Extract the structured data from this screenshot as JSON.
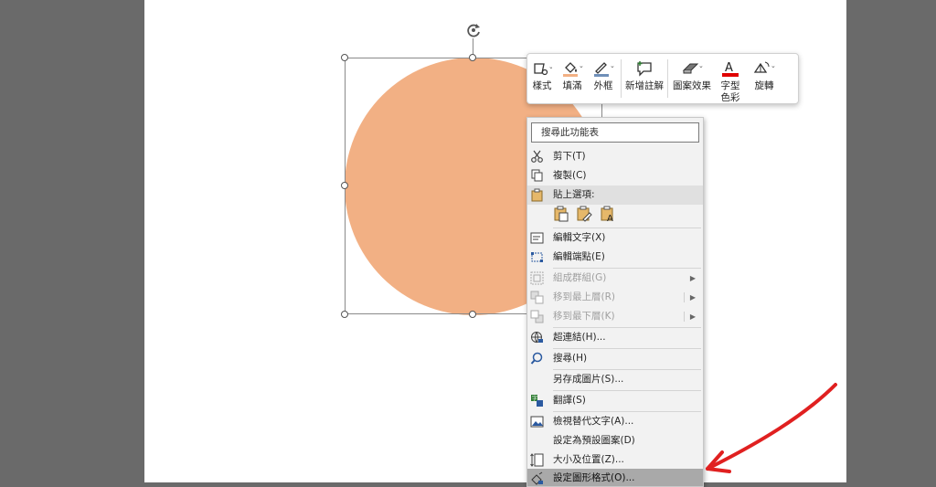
{
  "canvas": {
    "background": "#6a6a6a",
    "slide_background": "#ffffff",
    "shape_color": "#f2b084"
  },
  "mini_toolbar": {
    "style_label": "樣式",
    "fill_label": "填滿",
    "outline_label": "外框",
    "new_comment_label": "新增註解",
    "shape_effects_label": "圖案效果",
    "font_color_label": "字型色彩",
    "rotate_label": "旋轉"
  },
  "context_menu": {
    "search_label": "搜尋此功能表",
    "items": [
      {
        "label": "剪下(T)"
      },
      {
        "label": "複製(C)"
      },
      {
        "label": "貼上選項:"
      },
      {
        "label": "編輯文字(X)"
      },
      {
        "label": "編輯端點(E)"
      },
      {
        "label": "組成群組(G)"
      },
      {
        "label": "移到最上層(R)"
      },
      {
        "label": "移到最下層(K)"
      },
      {
        "label": "超連結(H)..."
      },
      {
        "label": "搜尋(H)"
      },
      {
        "label": "另存成圖片(S)..."
      },
      {
        "label": "翻譯(S)"
      },
      {
        "label": "檢視替代文字(A)..."
      },
      {
        "label": "設定為預設圖案(D)"
      },
      {
        "label": "大小及位置(Z)..."
      },
      {
        "label": "設定圖形格式(O)..."
      }
    ]
  },
  "annotation": {
    "arrow_color": "#e02020"
  }
}
